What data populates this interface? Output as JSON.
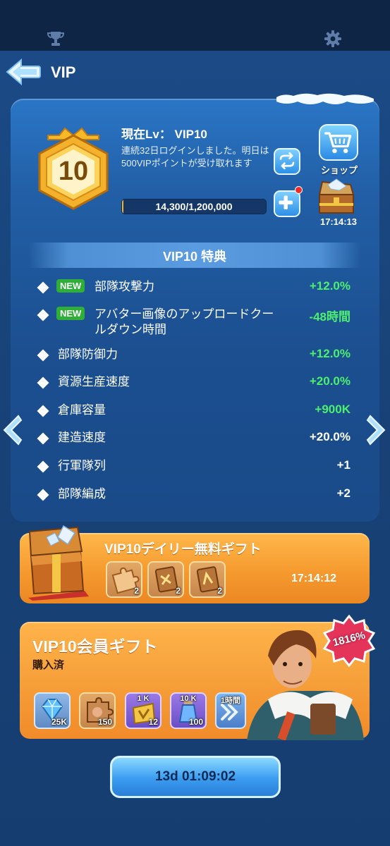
{
  "header": {
    "title": "VIP"
  },
  "vip": {
    "badge_level": "10",
    "current_level_label": "現在Lv： VIP10",
    "login_text": "連続32日ログインしました。明日は500VIPポイントが受け取れます",
    "progress_text": "14,300/1,200,000",
    "progress_fraction": 0.012,
    "shop_label": "ショップ",
    "chest_timer": "17:14:13"
  },
  "perks": {
    "title": "VIP10 特典",
    "new_tag": "NEW",
    "items": [
      {
        "name": "部隊攻撃力",
        "value": "+12.0%"
      },
      {
        "name": "アバター画像のアップロードクールダウン時間",
        "value": "-48時間"
      },
      {
        "name": "部隊防御力",
        "value": "+12.0%"
      },
      {
        "name": "資源生産速度",
        "value": "+20.0%"
      },
      {
        "name": "倉庫容量",
        "value": "+900K"
      },
      {
        "name": "建造速度",
        "value": "+20.0%"
      },
      {
        "name": "行軍隊列",
        "value": "+1"
      },
      {
        "name": "部隊編成",
        "value": "+2"
      }
    ]
  },
  "daily_gift": {
    "title": "VIP10デイリー無料ギフト",
    "items": [
      {
        "count": "2"
      },
      {
        "count": "2"
      },
      {
        "count": "2"
      }
    ],
    "timer": "17:14:12"
  },
  "member_gift": {
    "title": "VIP10会員ギフト",
    "status": "購入済",
    "percent": "1816%",
    "items": [
      {
        "top": "",
        "count": "25K"
      },
      {
        "top": "",
        "count": "150"
      },
      {
        "top": "1 K",
        "count": "12"
      },
      {
        "top": "10 K",
        "count": "100"
      },
      {
        "top": "1時間",
        "count": ""
      }
    ]
  },
  "countdown_button": {
    "label": "13d 01:09:02"
  },
  "colors": {
    "accent_green": "#4cf06e",
    "panel_blue": "#225fa6",
    "gift_orange": "#f59a2f"
  }
}
